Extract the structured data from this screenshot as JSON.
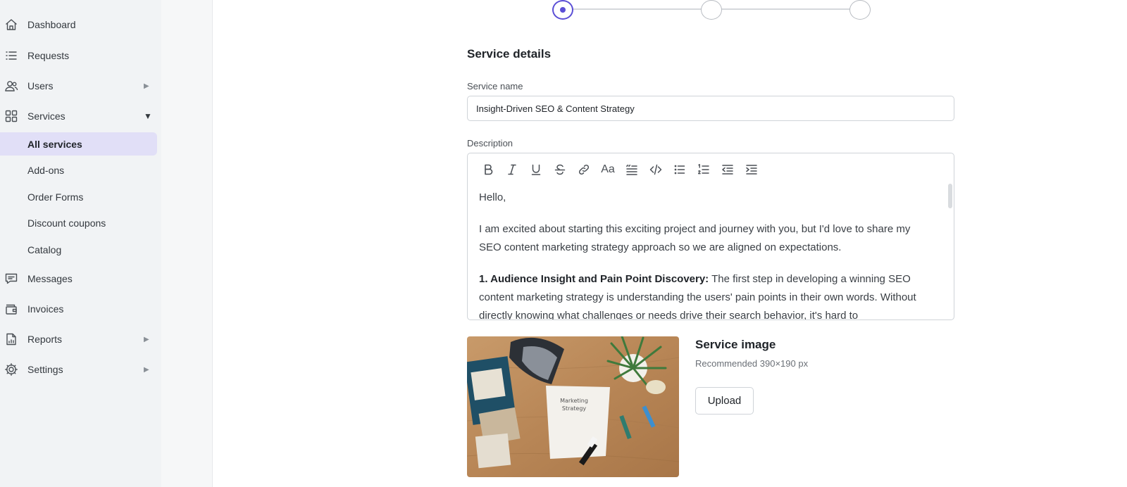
{
  "sidebar": {
    "nav": {
      "dashboard": "Dashboard",
      "requests": "Requests",
      "users": "Users",
      "services": "Services",
      "messages": "Messages",
      "invoices": "Invoices",
      "reports": "Reports",
      "settings": "Settings"
    },
    "services_sub": {
      "all_services": "All services",
      "add_ons": "Add-ons",
      "order_forms": "Order Forms",
      "discount_coupons": "Discount coupons",
      "catalog": "Catalog"
    },
    "active_item": "All services",
    "expand_arrow": "▶",
    "collapse_arrow": "▼"
  },
  "stepper": {
    "current_step": 1,
    "total_steps": 3,
    "accent_color": "#5b4fd6"
  },
  "form": {
    "section_title": "Service details",
    "service_name_label": "Service name",
    "service_name_value": "Insight-Driven SEO & Content Strategy",
    "description_label": "Description",
    "toolbar_icons": [
      "bold-icon",
      "italic-icon",
      "underline-icon",
      "strikethrough-icon",
      "link-icon",
      "font-size-icon",
      "blockquote-icon",
      "code-icon",
      "bullet-list-icon",
      "numbered-list-icon",
      "outdent-icon",
      "indent-icon"
    ],
    "font_size_glyph": "Aa",
    "description": {
      "greeting": "Hello,",
      "intro": "I am excited about starting this exciting project and journey with you, but I'd love to share my SEO content marketing strategy approach so we are aligned on expectations.",
      "point1_heading": "1. Audience Insight and Pain Point Discovery:",
      "point1_text": " The first step in developing a winning SEO content marketing strategy is understanding the users' pain points in their own words. Without directly knowing what challenges or needs drive their search behavior, it's hard to"
    },
    "image_section_title": "Service image",
    "image_hint": "Recommended 390×190 px",
    "upload_label": "Upload",
    "image_caption_note": "Marketing Strategy"
  }
}
